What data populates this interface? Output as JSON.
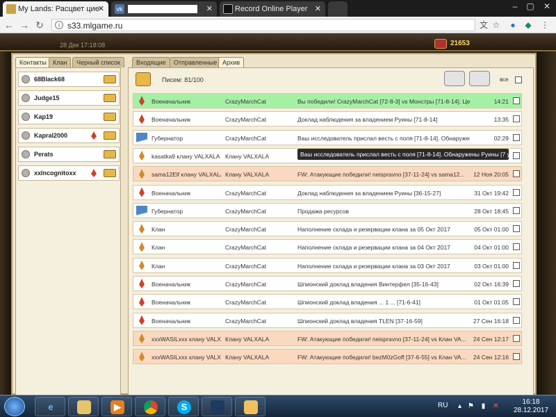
{
  "browser": {
    "tabs": [
      {
        "title": "My Lands: Расцвет цие",
        "active": true
      },
      {
        "title": "",
        "active": false
      },
      {
        "title": "Record Online Player",
        "active": false
      }
    ],
    "url": "s33.mlgame.ru"
  },
  "game": {
    "topbar": {
      "date_text": "28 Дек 17:18:08",
      "gold": "21653"
    },
    "left_tabs": [
      "Контакты",
      "Клан",
      "Черный список"
    ],
    "contacts": [
      {
        "name": "68Black68",
        "has_wing": false
      },
      {
        "name": "Judge15",
        "has_wing": false
      },
      {
        "name": "Kap19",
        "has_wing": false
      },
      {
        "name": "Kapral2000",
        "has_wing": true
      },
      {
        "name": "Perats",
        "has_wing": false
      },
      {
        "name": "xxIncognitoxx",
        "has_wing": true
      }
    ],
    "mail_tabs": [
      "Входящие",
      "Отправленные",
      "Архив"
    ],
    "letters_label": "Писем: 81/100",
    "all_label": "все",
    "tooltip": "Ваш исследователь прислал весть с поля [71-8-14]. Обнаружены Руины [7 ур]",
    "messages": [
      {
        "icon": "warlord",
        "from": "Военачальник",
        "to": "CrazyMarchCat",
        "subject": "Вы победили! CrazyMarchCat [72-8-3] vs Монстры [71-8-14]. Цель: Г...",
        "time": "14:21",
        "tone": "green"
      },
      {
        "icon": "warlord",
        "from": "Военачальник",
        "to": "CrazyMarchCat",
        "subject": "Доклад наблюдения за владением Руины [71-8-14]",
        "time": "13:35",
        "tone": "white"
      },
      {
        "icon": "governor",
        "from": "Губернатор",
        "to": "CrazyMarchCat",
        "subject": "Ваш исследователь прислал весть с поля [71-8-14]. Обнаружены Руи...",
        "time": "02:29",
        "tone": "white"
      },
      {
        "icon": "clan",
        "from": "kasatka9 клану VALXALA",
        "to": "Клану VALXALA",
        "subject": "",
        "time": "",
        "tone": "white"
      },
      {
        "icon": "clan",
        "from": "sama12Elf клану VALXALA",
        "to": "Клану VALXALA",
        "subject": "FW: Атакующие победили! neispravno [37-11-24] vs sama12...",
        "time": "12 Ноя 20:05",
        "tone": "orange"
      },
      {
        "icon": "warlord",
        "from": "Военачальник",
        "to": "CrazyMarchCat",
        "subject": "Доклад наблюдения за владением Руины [36-15-27]",
        "time": "31 Окт 19:42",
        "tone": "white"
      },
      {
        "icon": "governor",
        "from": "Губернатор",
        "to": "CrazyMarchCat",
        "subject": "Продажа ресурсов",
        "time": "28 Окт 18:45",
        "tone": "white"
      },
      {
        "icon": "clan",
        "from": "Клан",
        "to": "CrazyMarchCat",
        "subject": "Наполнение склада и резервации клана за 05 Окт 2017",
        "time": "05 Окт 01:00",
        "tone": "white"
      },
      {
        "icon": "clan",
        "from": "Клан",
        "to": "CrazyMarchCat",
        "subject": "Наполнение склада и резервации клана за 04 Окт 2017",
        "time": "04 Окт 01:00",
        "tone": "white"
      },
      {
        "icon": "clan",
        "from": "Клан",
        "to": "CrazyMarchCat",
        "subject": "Наполнение склада и резервации клана за 03 Окт 2017",
        "time": "03 Окт 01:00",
        "tone": "white"
      },
      {
        "icon": "warlord",
        "from": "Военачальник",
        "to": "CrazyMarchCat",
        "subject": "Шпионский доклад владения Винтерфел [35-16-43]",
        "time": "02 Окт 16:39",
        "tone": "white"
      },
      {
        "icon": "warlord",
        "from": "Военачальник",
        "to": "CrazyMarchCat",
        "subject": "Шпионский доклад владения ... 1 ... [71-6-41]",
        "time": "01 Окт 01:05",
        "tone": "white"
      },
      {
        "icon": "warlord",
        "from": "Военачальник",
        "to": "CrazyMarchCat",
        "subject": "Шпионский доклад владения TLEN [37-16-59]",
        "time": "27 Сен 16:18",
        "tone": "white"
      },
      {
        "icon": "clan",
        "from": "xxxWASILxxx клану VALXA",
        "to": "Клану VALXALA",
        "subject": "FW: Атакующие победили! neispravno [37-11-24] vs Клан VA...",
        "time": "24 Сен 12:17",
        "tone": "orange"
      },
      {
        "icon": "clan",
        "from": "xxxWASILxxx клану VALXA",
        "to": "Клану VALXALA",
        "subject": "FW: Атакующие победили! bezM0zGoff [37-6-55] vs Клан VA...",
        "time": "24 Сен 12:16",
        "tone": "orange"
      }
    ]
  },
  "taskbar": {
    "lang": "RU",
    "time": "16:18",
    "date": "28.12.2017"
  }
}
